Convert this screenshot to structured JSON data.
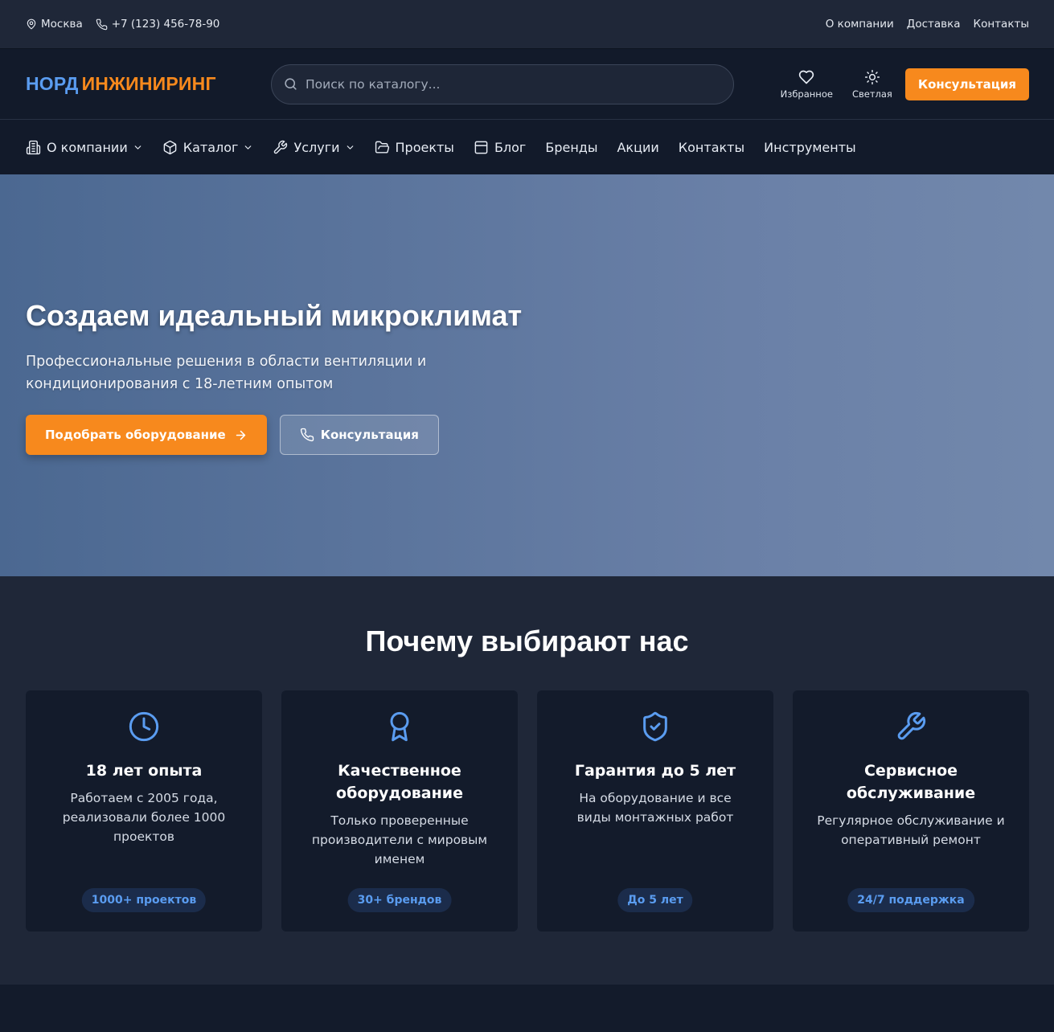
{
  "topbar": {
    "city": "Москва",
    "phone": "+7 (123) 456-78-90",
    "links": [
      "О компании",
      "Доставка",
      "Контакты"
    ]
  },
  "header": {
    "logo_part1": "НОРД",
    "logo_part2": "ИНЖИНИРИНГ",
    "search_placeholder": "Поиск по каталогу...",
    "favorites_label": "Избранное",
    "theme_label": "Светлая",
    "consult_button": "Консультация"
  },
  "nav": {
    "items": [
      {
        "label": "О компании",
        "icon": "building-icon",
        "dropdown": true
      },
      {
        "label": "Каталог",
        "icon": "box-icon",
        "dropdown": true
      },
      {
        "label": "Услуги",
        "icon": "wrench-icon",
        "dropdown": true
      },
      {
        "label": "Проекты",
        "icon": "folder-icon",
        "dropdown": false
      },
      {
        "label": "Блог",
        "icon": "newspaper-icon",
        "dropdown": false
      },
      {
        "label": "Бренды",
        "dropdown": false
      },
      {
        "label": "Акции",
        "dropdown": false
      },
      {
        "label": "Контакты",
        "dropdown": false
      },
      {
        "label": "Инструменты",
        "dropdown": false
      }
    ]
  },
  "hero": {
    "title": "Создаем идеальный микроклимат",
    "subtitle": "Профессиональные решения в области вентиляции и кондиционирования с 18-летним опытом",
    "primary_button": "Подобрать оборудование",
    "secondary_button": "Консультация"
  },
  "features": {
    "title": "Почему выбирают нас",
    "cards": [
      {
        "icon": "clock-icon",
        "title": "18 лет опыта",
        "description": "Работаем с 2005 года, реализовали более 1000 проектов",
        "badge": "1000+ проектов"
      },
      {
        "icon": "award-icon",
        "title": "Качественное оборудование",
        "description": "Только проверенные производители с мировым именем",
        "badge": "30+ брендов"
      },
      {
        "icon": "shield-check-icon",
        "title": "Гарантия до 5 лет",
        "description": "На оборудование и все виды монтажных работ",
        "badge": "До 5 лет"
      },
      {
        "icon": "wrench-icon",
        "title": "Сервисное обслуживание",
        "description": "Регулярное обслуживание и оперативный ремонт",
        "badge": "24/7 поддержка"
      }
    ]
  },
  "colors": {
    "accent_orange": "#f7891d",
    "accent_blue": "#5a9cf0",
    "dark_bg": "#121a2a",
    "section_bg": "#1f2738"
  }
}
